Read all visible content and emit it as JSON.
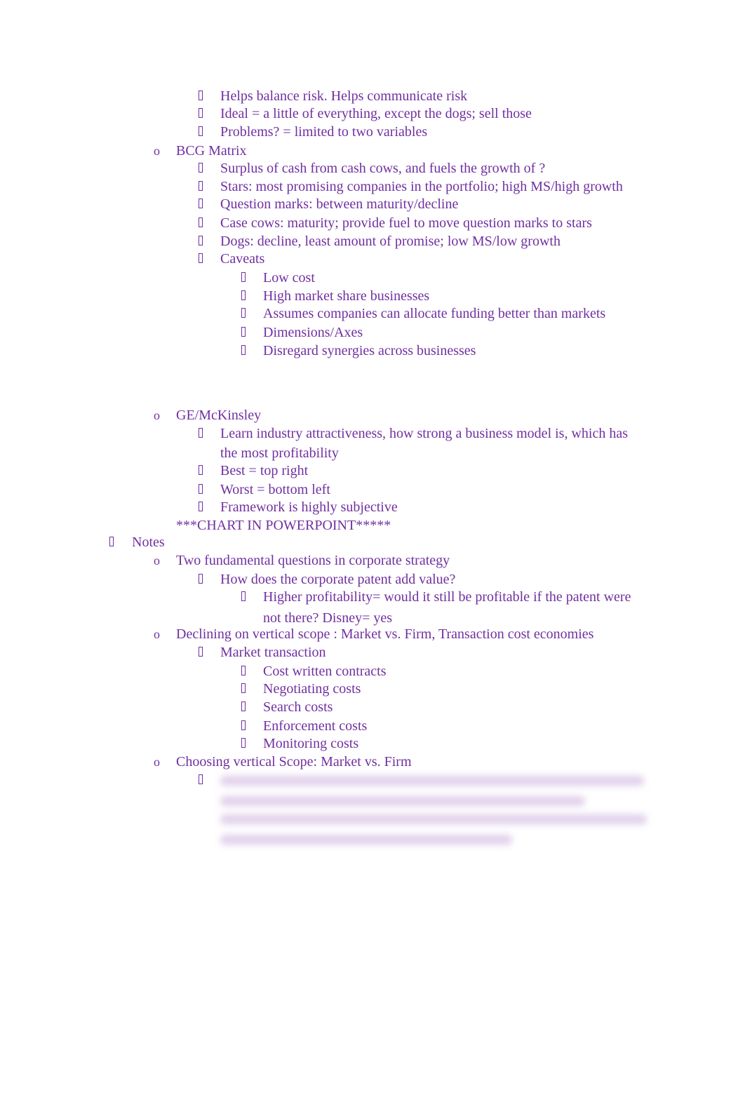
{
  "colors": {
    "text": "#7030A0"
  },
  "lines": [
    {
      "level": 3,
      "text": "Helps balance risk. Helps communicate risk"
    },
    {
      "level": 3,
      "text": "Ideal = a little of everything, except the dogs; sell those"
    },
    {
      "level": 3,
      "text": "Problems? = limited to two variables"
    },
    {
      "level": 2,
      "text": "BCG Matrix"
    },
    {
      "level": 3,
      "text": "Surplus of cash from cash cows, and fuels the growth of ?"
    },
    {
      "level": 3,
      "text": "Stars: most promising companies in the portfolio; high MS/high growth"
    },
    {
      "level": 3,
      "text": "Question marks: between maturity/decline"
    },
    {
      "level": 3,
      "text": "Case cows: maturity; provide fuel to move question marks to stars"
    },
    {
      "level": 3,
      "text": "Dogs: decline, least amount of promise; low MS/low growth"
    },
    {
      "level": 3,
      "text": "Caveats"
    },
    {
      "level": 4,
      "text": "Low cost"
    },
    {
      "level": 4,
      "text": "High market share businesses"
    },
    {
      "level": 4,
      "text": "Assumes companies can allocate funding better than markets"
    },
    {
      "level": 4,
      "text": "Dimensions/Axes"
    },
    {
      "level": 4,
      "text": "Disregard synergies across businesses"
    },
    {
      "level": 2,
      "text": "GE/McKinsley"
    },
    {
      "level": 3,
      "text": "Learn industry attractiveness, how strong a business model is, which has"
    },
    {
      "level": 3,
      "cont": true,
      "text": "the most profitability"
    },
    {
      "level": 3,
      "text": "Best = top right"
    },
    {
      "level": 3,
      "text": "Worst = bottom left"
    },
    {
      "level": 3,
      "text": "Framework is highly subjective"
    },
    {
      "level": 2,
      "cont": true,
      "text": "***CHART IN POWERPOINT*****"
    },
    {
      "level": 1,
      "text": "Notes"
    },
    {
      "level": 2,
      "text": "Two fundamental questions in corporate strategy"
    },
    {
      "level": 3,
      "text": "How does the corporate patent add value?"
    },
    {
      "level": 4,
      "text": "Higher profitability= would it still be profitable if the patent were"
    },
    {
      "level": 4,
      "cont": true,
      "text": "not there? Disney= yes"
    },
    {
      "level": 2,
      "text": "Declining on vertical scope : Market vs. Firm, Transaction cost economies"
    },
    {
      "level": 3,
      "text": "Market transaction"
    },
    {
      "level": 4,
      "text": "Cost written contracts"
    },
    {
      "level": 4,
      "text": "Negotiating costs"
    },
    {
      "level": 4,
      "text": "Search costs"
    },
    {
      "level": 4,
      "text": "Enforcement costs"
    },
    {
      "level": 4,
      "text": "Monitoring costs"
    },
    {
      "level": 2,
      "text": "Choosing vertical Scope: Market vs. Firm"
    },
    {
      "level": 3,
      "text": ""
    }
  ]
}
